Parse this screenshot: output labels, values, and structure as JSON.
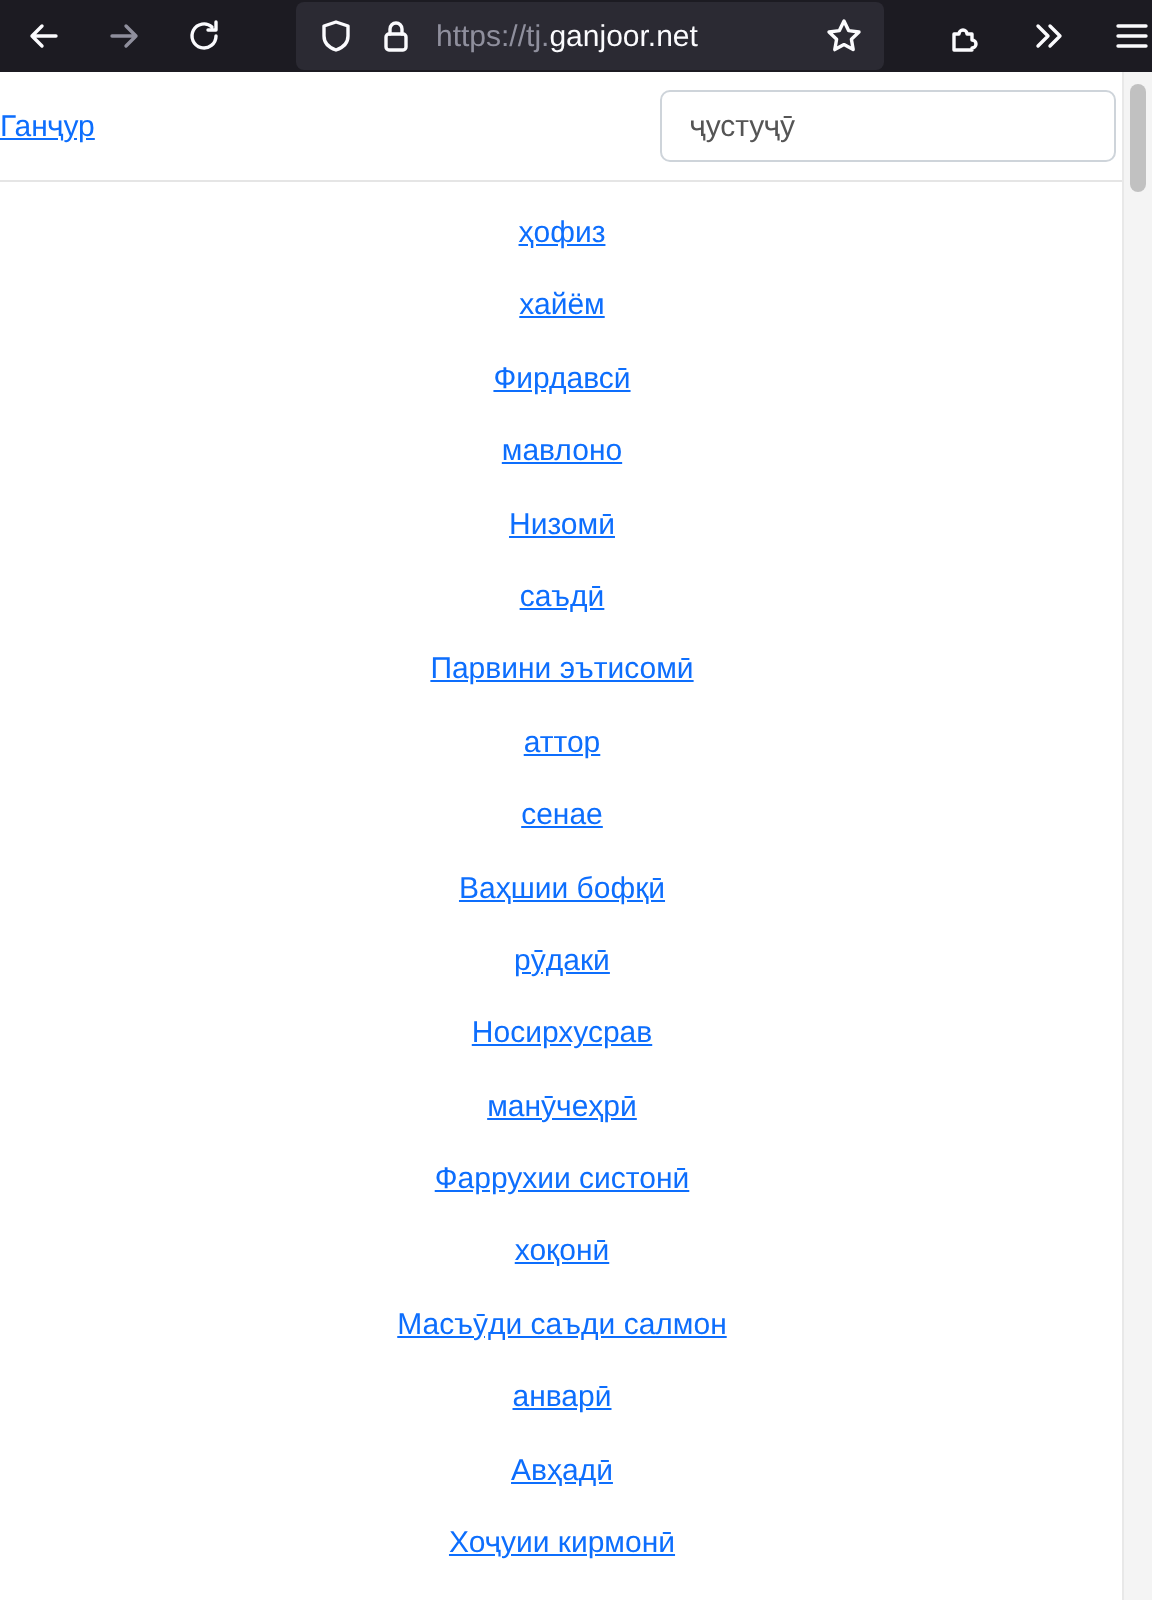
{
  "browser": {
    "url_prefix": "https://tj.",
    "url_host": "ganjoor.net",
    "forward_disabled": true
  },
  "header": {
    "site_link": "Ганҷур",
    "search": {
      "placeholder": "ҷустуҷӯ"
    }
  },
  "poets": [
    {
      "name": "ҳофиз"
    },
    {
      "name": "хайём"
    },
    {
      "name": "Фирдавсӣ"
    },
    {
      "name": "мавлоно"
    },
    {
      "name": "Низомӣ"
    },
    {
      "name": "саъдӣ"
    },
    {
      "name": "Парвини эътисомӣ"
    },
    {
      "name": "аттор"
    },
    {
      "name": "сенае"
    },
    {
      "name": "Ваҳшии бофқӣ"
    },
    {
      "name": "рӯдакӣ"
    },
    {
      "name": "Носирхусрав"
    },
    {
      "name": "манӯчеҳрӣ"
    },
    {
      "name": "Фаррухии систонӣ"
    },
    {
      "name": "хоқонӣ"
    },
    {
      "name": "Масъӯди саъди салмон"
    },
    {
      "name": "анварӣ"
    },
    {
      "name": "Авҳадӣ"
    },
    {
      "name": "Хоҷуии кирмонӣ"
    }
  ]
}
